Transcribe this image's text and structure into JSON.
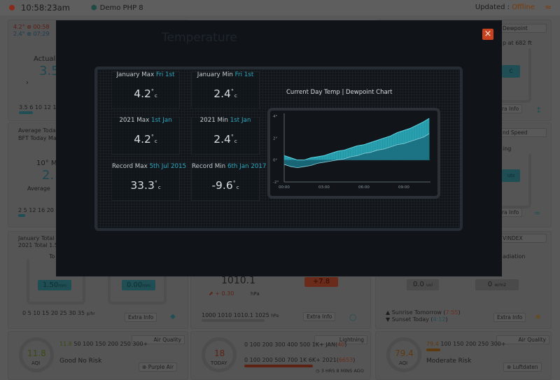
{
  "header": {
    "time": "10:58:23am",
    "station": "Demo PHP 8",
    "updated_label": "Updated :",
    "updated_status": "Offline"
  },
  "dashboard": {
    "temp_panel": {
      "max_line": "4.2° ⊕ 00:58",
      "min_line": "2.4° ⊕ 07:29",
      "actual": "Actual T",
      "value": "3.5",
      "scale": "3.5 6 10 12 15 3"
    },
    "dewpoint_panel": {
      "title": "Dewpoint",
      "line": "p at 682 ft",
      "value": "c",
      "extra": "tra Info"
    },
    "wind_panel": {
      "avg_today": "Average Today",
      "bft": "BFT Today Ma",
      "max_label": "10° Ma",
      "value": "2.",
      "average": "Average",
      "scale": "2 5 12 16 20 26"
    },
    "windspeed_panel": {
      "title": "nd Speed",
      "line": "ing",
      "value": "uts",
      "extra": "tra Info"
    },
    "rain_panel": {
      "jan_total": "January Total",
      "year_total": "2021 Total 1.5",
      "today_label": "To",
      "rate1": "1.50",
      "rate1_unit": "mm",
      "rate2": "0.00",
      "rate2_unit": "mm",
      "scale": "0 5 10 15 20 25 30 35",
      "scale_unit": "p/hr",
      "extra": "Extra Info"
    },
    "pressure_panel": {
      "value": "1010.1",
      "change": "⬈ + 0.30",
      "unit": "hPa",
      "badge": "+7.8",
      "scale": "1000 1010 1010.1 1025",
      "scale_unit": "hPa",
      "extra": "Extra Info"
    },
    "uv_panel": {
      "title": "VINDEX",
      "radiation": "adiation",
      "val1": "0.0",
      "val1_unit": "uvi",
      "val2": "0",
      "val2_unit": "w/m2",
      "sunrise": "Sunrise Tomorrow",
      "sunrise_time": "7:55",
      "sunset": "Sunset Today",
      "sunset_time": "4:12",
      "extra": "Extra Info"
    },
    "aq1_panel": {
      "title": "Air Quality",
      "value": "11.8",
      "aqi": "AQI",
      "scale_hl": "11.8",
      "scale": "50 100 150 200 250 300+",
      "status": "Good No Risk",
      "link": "Purple Air"
    },
    "lightning_panel": {
      "title": "Lightning",
      "value": "18",
      "today": "TODAY",
      "scale1": "0 100 200 300 400 500 1K+ JAN",
      "scale1_hl": "40",
      "scale2": "0 100 200 500 700 1K 6K+ 2021",
      "scale2_hl": "6653",
      "ago": "3 HRS 8 MINS AGO"
    },
    "aq2_panel": {
      "title": "Air Quality",
      "value": "79.4",
      "aqi": "AQI",
      "scale_hl": "79.4",
      "scale": "100 150 200 250 300+",
      "status": "Moderate Risk",
      "link": "Luftdaten"
    }
  },
  "modal": {
    "title": "Temperature",
    "close_label": "×",
    "stats": [
      {
        "label": "January Max",
        "date": "Fri 1st",
        "value": "4.2",
        "unit": "c"
      },
      {
        "label": "January Min",
        "date": "Fri 1st",
        "value": "2.4",
        "unit": "c"
      },
      {
        "label": "2021 Max",
        "date": "1st Jan",
        "value": "4.2",
        "unit": "c"
      },
      {
        "label": "2021 Min",
        "date": "1st Jan",
        "value": "2.4",
        "unit": "c"
      },
      {
        "label": "Record Max",
        "date": "5th Jul 2015",
        "value": "33.3",
        "unit": "c"
      },
      {
        "label": "Record Min",
        "date": "6th Jan 2017",
        "value": "-9.6",
        "unit": "c"
      }
    ],
    "chart_title": "Current Day Temp | Dewpoint Chart"
  },
  "chart_data": {
    "type": "area",
    "title": "Current Day Temp | Dewpoint Chart",
    "y_ticks": [
      "4°",
      "2°",
      "0°",
      "-2°"
    ],
    "x_ticks": [
      "00:00",
      "03:00",
      "06:00",
      "09:00"
    ],
    "ylim": [
      -2,
      4
    ],
    "xlim": [
      0,
      11
    ],
    "series": [
      {
        "values_hint": "temperature",
        "x": [
          0,
          0.5,
          1,
          1.5,
          2,
          2.5,
          3,
          3.5,
          4,
          4.5,
          5,
          5.5,
          6,
          6.5,
          7,
          7.5,
          8,
          8.5,
          9,
          9.5,
          10,
          10.5,
          10.9
        ],
        "y": [
          0.4,
          0.2,
          0.0,
          0.0,
          0.2,
          0.3,
          0.4,
          0.6,
          0.8,
          0.9,
          1.1,
          1.3,
          1.4,
          1.6,
          1.8,
          2.0,
          2.2,
          2.5,
          2.7,
          2.9,
          3.2,
          3.5,
          3.8
        ]
      },
      {
        "values_hint": "dewpoint",
        "x": [
          0,
          0.5,
          1,
          1.5,
          2,
          2.5,
          3,
          3.5,
          4,
          4.5,
          5,
          5.5,
          6,
          6.5,
          7,
          7.5,
          8,
          8.5,
          9,
          9.5,
          10,
          10.5,
          10.9
        ],
        "y": [
          -0.4,
          -0.6,
          -0.7,
          -0.6,
          -0.5,
          -0.3,
          -0.2,
          -0.1,
          0.0,
          0.1,
          0.3,
          0.4,
          0.6,
          0.7,
          0.9,
          1.0,
          1.2,
          1.4,
          1.5,
          1.7,
          1.9,
          2.1,
          2.4
        ]
      }
    ],
    "colors": {
      "temp": "#2fb7c9",
      "dew": "#1a6e80"
    }
  }
}
